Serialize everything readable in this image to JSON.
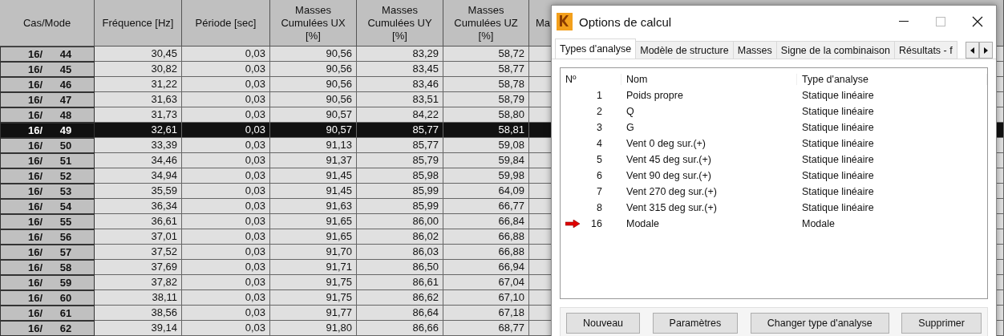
{
  "table": {
    "columns": [
      "Cas/Mode",
      "Fréquence [Hz]",
      "Période [sec]",
      "Masses\nCumulées UX\n[%]",
      "Masses\nCumulées UY\n[%]",
      "Masses\nCumulées UZ\n[%]",
      "Ma"
    ],
    "rows": [
      {
        "cells": [
          "16/      44",
          "30,45",
          "0,03",
          "90,56",
          "83,29",
          "58,72"
        ],
        "selected": false
      },
      {
        "cells": [
          "16/      45",
          "30,82",
          "0,03",
          "90,56",
          "83,45",
          "58,77"
        ],
        "selected": false
      },
      {
        "cells": [
          "16/      46",
          "31,22",
          "0,03",
          "90,56",
          "83,46",
          "58,78"
        ],
        "selected": false
      },
      {
        "cells": [
          "16/      47",
          "31,63",
          "0,03",
          "90,56",
          "83,51",
          "58,79"
        ],
        "selected": false
      },
      {
        "cells": [
          "16/      48",
          "31,73",
          "0,03",
          "90,57",
          "84,22",
          "58,80"
        ],
        "selected": false
      },
      {
        "cells": [
          "16/      49",
          "32,61",
          "0,03",
          "90,57",
          "85,77",
          "58,81"
        ],
        "selected": true
      },
      {
        "cells": [
          "16/      50",
          "33,39",
          "0,03",
          "91,13",
          "85,77",
          "59,08"
        ],
        "selected": false
      },
      {
        "cells": [
          "16/      51",
          "34,46",
          "0,03",
          "91,37",
          "85,79",
          "59,84"
        ],
        "selected": false
      },
      {
        "cells": [
          "16/      52",
          "34,94",
          "0,03",
          "91,45",
          "85,98",
          "59,98"
        ],
        "selected": false
      },
      {
        "cells": [
          "16/      53",
          "35,59",
          "0,03",
          "91,45",
          "85,99",
          "64,09"
        ],
        "selected": false
      },
      {
        "cells": [
          "16/      54",
          "36,34",
          "0,03",
          "91,63",
          "85,99",
          "66,77"
        ],
        "selected": false
      },
      {
        "cells": [
          "16/      55",
          "36,61",
          "0,03",
          "91,65",
          "86,00",
          "66,84"
        ],
        "selected": false
      },
      {
        "cells": [
          "16/      56",
          "37,01",
          "0,03",
          "91,65",
          "86,02",
          "66,88"
        ],
        "selected": false
      },
      {
        "cells": [
          "16/      57",
          "37,52",
          "0,03",
          "91,70",
          "86,03",
          "66,88"
        ],
        "selected": false
      },
      {
        "cells": [
          "16/      58",
          "37,69",
          "0,03",
          "91,71",
          "86,50",
          "66,94"
        ],
        "selected": false
      },
      {
        "cells": [
          "16/      59",
          "37,82",
          "0,03",
          "91,75",
          "86,61",
          "67,04"
        ],
        "selected": false
      },
      {
        "cells": [
          "16/      60",
          "38,11",
          "0,03",
          "91,75",
          "86,62",
          "67,10"
        ],
        "selected": false
      },
      {
        "cells": [
          "16/      61",
          "38,56",
          "0,03",
          "91,77",
          "86,64",
          "67,18"
        ],
        "selected": false
      },
      {
        "cells": [
          "16/      62",
          "39,14",
          "0,03",
          "91,80",
          "86,66",
          "68,77"
        ],
        "selected": false
      }
    ]
  },
  "dialog": {
    "title": "Options de calcul",
    "tabs": [
      {
        "label": "Types d'analyse",
        "selected": true
      },
      {
        "label": "Modèle de structure",
        "selected": false
      },
      {
        "label": "Masses",
        "selected": false
      },
      {
        "label": "Signe de la combinaison",
        "selected": false
      },
      {
        "label": "Résultats - f",
        "selected": false
      }
    ],
    "list": {
      "columns": [
        "Nº",
        "Nom",
        "Type d'analyse"
      ],
      "rows": [
        {
          "no": "1",
          "name": "Poids propre",
          "type": "Statique linéaire",
          "current": false
        },
        {
          "no": "2",
          "name": "Q",
          "type": "Statique linéaire",
          "current": false
        },
        {
          "no": "3",
          "name": "G",
          "type": "Statique linéaire",
          "current": false
        },
        {
          "no": "4",
          "name": "Vent 0 deg sur.(+)",
          "type": "Statique linéaire",
          "current": false
        },
        {
          "no": "5",
          "name": "Vent 45 deg sur.(+)",
          "type": "Statique linéaire",
          "current": false
        },
        {
          "no": "6",
          "name": "Vent 90 deg sur.(+)",
          "type": "Statique linéaire",
          "current": false
        },
        {
          "no": "7",
          "name": "Vent 270 deg sur.(+)",
          "type": "Statique linéaire",
          "current": false
        },
        {
          "no": "8",
          "name": "Vent 315 deg sur.(+)",
          "type": "Statique linéaire",
          "current": false
        },
        {
          "no": "16",
          "name": "Modale",
          "type": "Modale",
          "current": true
        }
      ]
    },
    "buttons": [
      "Nouveau",
      "Paramètres",
      "Changer type d'analyse",
      "Supprimer"
    ]
  }
}
